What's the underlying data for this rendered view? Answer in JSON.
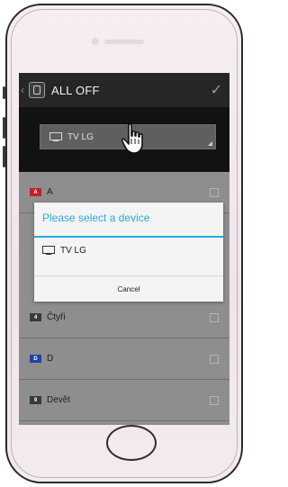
{
  "action_bar": {
    "back_glyph": "‹",
    "title": "ALL OFF",
    "confirm_icon": "check-icon",
    "app_icon": "remote-app-icon"
  },
  "device_selector": {
    "label": "TV LG",
    "icon": "tv-icon"
  },
  "list": {
    "items": [
      {
        "badge": "A",
        "badge_color": "#c0202a",
        "label": "A"
      },
      {
        "badge": "4",
        "badge_color": "#3a3a3a",
        "label": "Čtyři"
      },
      {
        "badge": "D",
        "badge_color": "#2541a6",
        "label": "D"
      },
      {
        "badge": "9",
        "badge_color": "#3a3a3a",
        "label": "Devět"
      }
    ]
  },
  "dialog": {
    "title": "Please select a device",
    "options": [
      {
        "label": "TV LG",
        "icon": "tv-icon"
      }
    ],
    "cancel_label": "Cancel",
    "accent_color": "#2aa9dd"
  }
}
